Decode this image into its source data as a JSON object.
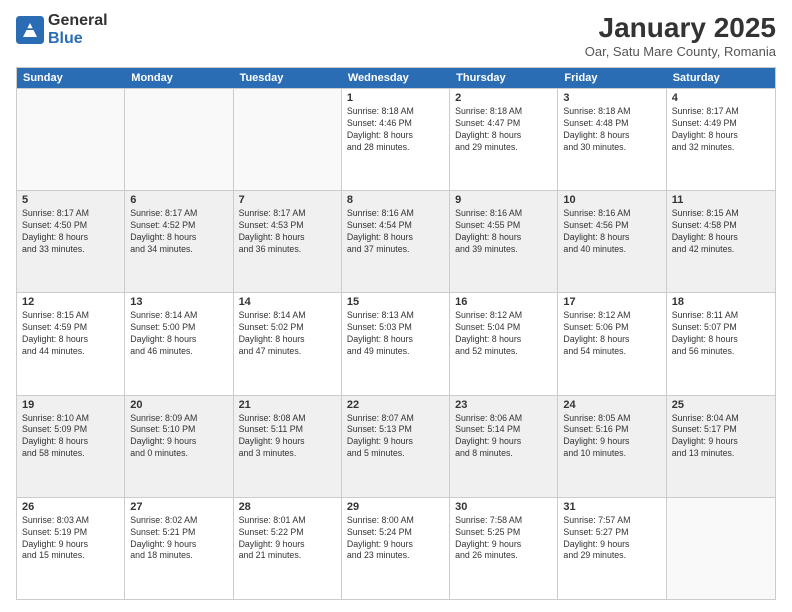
{
  "logo": {
    "general": "General",
    "blue": "Blue"
  },
  "title": "January 2025",
  "subtitle": "Oar, Satu Mare County, Romania",
  "days": [
    "Sunday",
    "Monday",
    "Tuesday",
    "Wednesday",
    "Thursday",
    "Friday",
    "Saturday"
  ],
  "weeks": [
    [
      {
        "day": "",
        "info": ""
      },
      {
        "day": "",
        "info": ""
      },
      {
        "day": "",
        "info": ""
      },
      {
        "day": "1",
        "info": "Sunrise: 8:18 AM\nSunset: 4:46 PM\nDaylight: 8 hours\nand 28 minutes."
      },
      {
        "day": "2",
        "info": "Sunrise: 8:18 AM\nSunset: 4:47 PM\nDaylight: 8 hours\nand 29 minutes."
      },
      {
        "day": "3",
        "info": "Sunrise: 8:18 AM\nSunset: 4:48 PM\nDaylight: 8 hours\nand 30 minutes."
      },
      {
        "day": "4",
        "info": "Sunrise: 8:17 AM\nSunset: 4:49 PM\nDaylight: 8 hours\nand 32 minutes."
      }
    ],
    [
      {
        "day": "5",
        "info": "Sunrise: 8:17 AM\nSunset: 4:50 PM\nDaylight: 8 hours\nand 33 minutes."
      },
      {
        "day": "6",
        "info": "Sunrise: 8:17 AM\nSunset: 4:52 PM\nDaylight: 8 hours\nand 34 minutes."
      },
      {
        "day": "7",
        "info": "Sunrise: 8:17 AM\nSunset: 4:53 PM\nDaylight: 8 hours\nand 36 minutes."
      },
      {
        "day": "8",
        "info": "Sunrise: 8:16 AM\nSunset: 4:54 PM\nDaylight: 8 hours\nand 37 minutes."
      },
      {
        "day": "9",
        "info": "Sunrise: 8:16 AM\nSunset: 4:55 PM\nDaylight: 8 hours\nand 39 minutes."
      },
      {
        "day": "10",
        "info": "Sunrise: 8:16 AM\nSunset: 4:56 PM\nDaylight: 8 hours\nand 40 minutes."
      },
      {
        "day": "11",
        "info": "Sunrise: 8:15 AM\nSunset: 4:58 PM\nDaylight: 8 hours\nand 42 minutes."
      }
    ],
    [
      {
        "day": "12",
        "info": "Sunrise: 8:15 AM\nSunset: 4:59 PM\nDaylight: 8 hours\nand 44 minutes."
      },
      {
        "day": "13",
        "info": "Sunrise: 8:14 AM\nSunset: 5:00 PM\nDaylight: 8 hours\nand 46 minutes."
      },
      {
        "day": "14",
        "info": "Sunrise: 8:14 AM\nSunset: 5:02 PM\nDaylight: 8 hours\nand 47 minutes."
      },
      {
        "day": "15",
        "info": "Sunrise: 8:13 AM\nSunset: 5:03 PM\nDaylight: 8 hours\nand 49 minutes."
      },
      {
        "day": "16",
        "info": "Sunrise: 8:12 AM\nSunset: 5:04 PM\nDaylight: 8 hours\nand 52 minutes."
      },
      {
        "day": "17",
        "info": "Sunrise: 8:12 AM\nSunset: 5:06 PM\nDaylight: 8 hours\nand 54 minutes."
      },
      {
        "day": "18",
        "info": "Sunrise: 8:11 AM\nSunset: 5:07 PM\nDaylight: 8 hours\nand 56 minutes."
      }
    ],
    [
      {
        "day": "19",
        "info": "Sunrise: 8:10 AM\nSunset: 5:09 PM\nDaylight: 8 hours\nand 58 minutes."
      },
      {
        "day": "20",
        "info": "Sunrise: 8:09 AM\nSunset: 5:10 PM\nDaylight: 9 hours\nand 0 minutes."
      },
      {
        "day": "21",
        "info": "Sunrise: 8:08 AM\nSunset: 5:11 PM\nDaylight: 9 hours\nand 3 minutes."
      },
      {
        "day": "22",
        "info": "Sunrise: 8:07 AM\nSunset: 5:13 PM\nDaylight: 9 hours\nand 5 minutes."
      },
      {
        "day": "23",
        "info": "Sunrise: 8:06 AM\nSunset: 5:14 PM\nDaylight: 9 hours\nand 8 minutes."
      },
      {
        "day": "24",
        "info": "Sunrise: 8:05 AM\nSunset: 5:16 PM\nDaylight: 9 hours\nand 10 minutes."
      },
      {
        "day": "25",
        "info": "Sunrise: 8:04 AM\nSunset: 5:17 PM\nDaylight: 9 hours\nand 13 minutes."
      }
    ],
    [
      {
        "day": "26",
        "info": "Sunrise: 8:03 AM\nSunset: 5:19 PM\nDaylight: 9 hours\nand 15 minutes."
      },
      {
        "day": "27",
        "info": "Sunrise: 8:02 AM\nSunset: 5:21 PM\nDaylight: 9 hours\nand 18 minutes."
      },
      {
        "day": "28",
        "info": "Sunrise: 8:01 AM\nSunset: 5:22 PM\nDaylight: 9 hours\nand 21 minutes."
      },
      {
        "day": "29",
        "info": "Sunrise: 8:00 AM\nSunset: 5:24 PM\nDaylight: 9 hours\nand 23 minutes."
      },
      {
        "day": "30",
        "info": "Sunrise: 7:58 AM\nSunset: 5:25 PM\nDaylight: 9 hours\nand 26 minutes."
      },
      {
        "day": "31",
        "info": "Sunrise: 7:57 AM\nSunset: 5:27 PM\nDaylight: 9 hours\nand 29 minutes."
      },
      {
        "day": "",
        "info": ""
      }
    ]
  ]
}
